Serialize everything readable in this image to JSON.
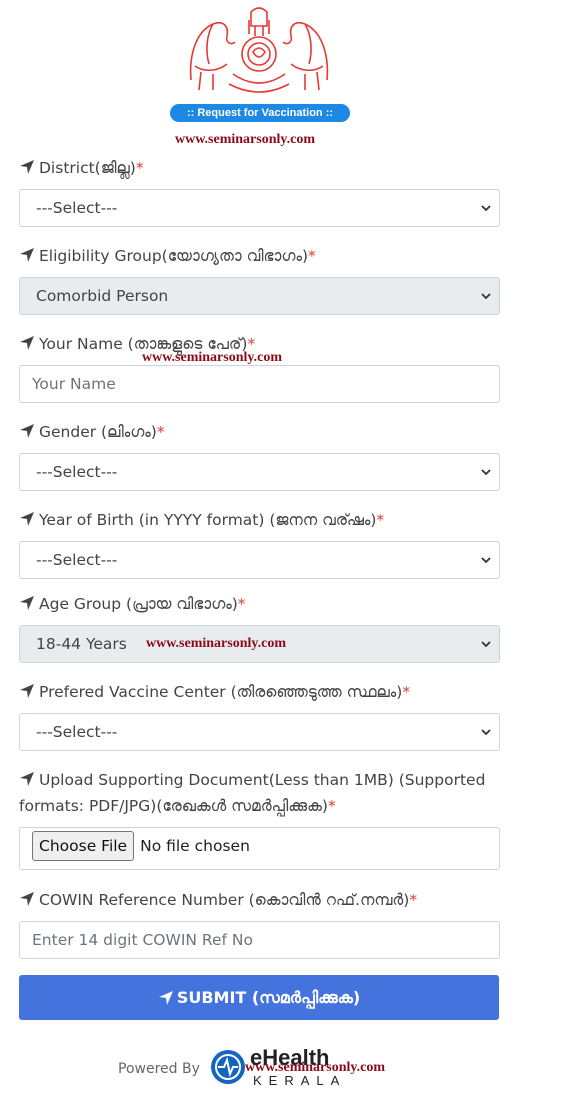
{
  "header": {
    "emblem_icon": "kerala-emblem-icon",
    "badge": ":: Request for Vaccination ::",
    "watermark": "www.seminarsonly.com"
  },
  "form": {
    "district": {
      "label": "District(ജില്ല)",
      "required": "*",
      "value": "---Select---"
    },
    "eligibility": {
      "label": "Eligibility Group(യോഗ്യതാ വിഭാഗം)",
      "required": "*",
      "value": "Comorbid Person"
    },
    "name": {
      "label": "Your Name (താങ്കളുടെ പേര്)",
      "required": "*",
      "placeholder": "Your Name"
    },
    "gender": {
      "label": "Gender (ലിംഗം)",
      "required": "*",
      "value": "---Select---"
    },
    "yob": {
      "label": "Year of Birth (in YYYY format) (ജനന വര്ഷം)",
      "required": "*",
      "value": "---Select---"
    },
    "age_group": {
      "label": "Age Group (പ്രായ വിഭാഗം)",
      "required": "*",
      "value": "18-44 Years"
    },
    "center": {
      "label": "Prefered Vaccine Center (തിരഞ്ഞെടുത്ത സ്ഥലം)",
      "required": "*",
      "value": "---Select---"
    },
    "upload": {
      "label": "Upload Supporting Document(Less than 1MB) (Supported formats: PDF/JPG)(രേഖകൾ സമർപ്പിക്കുക)",
      "required": "*",
      "button": "Choose File",
      "status": "No file chosen"
    },
    "cowin": {
      "label": "COWIN Reference Number (കൊവിൻ റഫ്.നമ്പർ)",
      "required": "*",
      "placeholder": "Enter 14 digit COWIN Ref No"
    },
    "submit": "SUBMIT (സമർപ്പിക്കുക)"
  },
  "footer": {
    "powered_by": "Powered By",
    "logo_title": "eHealth",
    "logo_subtitle": "KERALA"
  },
  "colors": {
    "accent": "#4473dd",
    "badge": "#1e88e5",
    "required": "#e53935",
    "watermark": "#8b0a1a",
    "emblem": "#e53935"
  },
  "icons": {
    "label_icon": "location-arrow-icon",
    "select_icon": "chevron-down-icon"
  }
}
